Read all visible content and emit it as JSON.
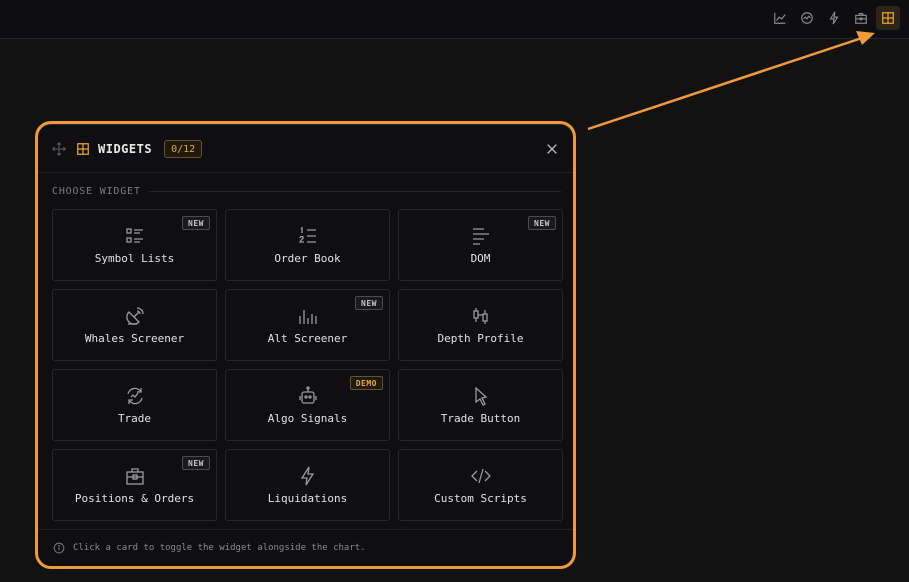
{
  "topbar": {
    "icons": [
      "chart-line-icon",
      "activity-circle-icon",
      "bolt-icon",
      "toolbox-icon",
      "widgets-grid-icon"
    ],
    "active_icon": "widgets-grid-icon"
  },
  "panel": {
    "title": "WIDGETS",
    "counter": "0/12",
    "section_title": "CHOOSE WIDGET",
    "footer_text": "Click a card to toggle the widget alongside the chart."
  },
  "widgets": [
    {
      "label": "Symbol Lists",
      "badge": "NEW",
      "icon": "list-icon"
    },
    {
      "label": "Order Book",
      "badge": "",
      "icon": "ordered-list-icon"
    },
    {
      "label": "DOM",
      "badge": "NEW",
      "icon": "align-left-icon"
    },
    {
      "label": "Whales Screener",
      "badge": "",
      "icon": "satellite-dish-icon"
    },
    {
      "label": "Alt Screener",
      "badge": "NEW",
      "icon": "bar-levels-icon"
    },
    {
      "label": "Depth Profile",
      "badge": "",
      "icon": "candlestick-icon"
    },
    {
      "label": "Trade",
      "badge": "",
      "icon": "trade-cycle-icon"
    },
    {
      "label": "Algo Signals",
      "badge": "DEMO",
      "icon": "robot-icon"
    },
    {
      "label": "Trade Button",
      "badge": "",
      "icon": "cursor-icon"
    },
    {
      "label": "Positions & Orders",
      "badge": "NEW",
      "icon": "briefcase-icon"
    },
    {
      "label": "Liquidations",
      "badge": "",
      "icon": "bolt-icon"
    },
    {
      "label": "Custom Scripts",
      "badge": "",
      "icon": "code-icon"
    }
  ],
  "colors": {
    "accent": "#f0a62a",
    "highlight": "#f09a3a",
    "background": "#121212"
  }
}
